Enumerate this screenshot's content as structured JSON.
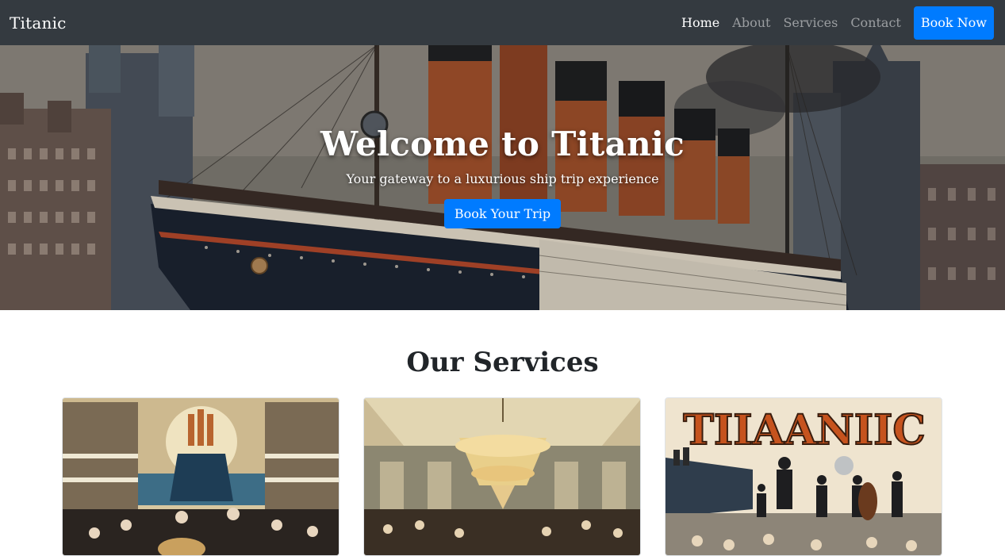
{
  "navbar": {
    "brand": "Titanic",
    "links": [
      {
        "label": "Home",
        "active": true
      },
      {
        "label": "About",
        "active": false
      },
      {
        "label": "Services",
        "active": false
      },
      {
        "label": "Contact",
        "active": false
      }
    ],
    "cta_label": "Book Now"
  },
  "hero": {
    "title": "Welcome to Titanic",
    "subtitle": "Your gateway to a luxurious ship trip experience",
    "button_label": "Book Your Trip"
  },
  "services": {
    "heading": "Our Services",
    "cards": [
      {
        "image_alt_semantic": "deck-dining-image",
        "poster_text": ""
      },
      {
        "image_alt_semantic": "grand-ballroom-image",
        "poster_text": ""
      },
      {
        "image_alt_semantic": "entertainment-poster-image",
        "poster_text": "TIIAANIIC"
      }
    ]
  },
  "colors": {
    "navbar_bg": "#343a40",
    "primary": "#007bff",
    "text_dark": "#212529"
  }
}
